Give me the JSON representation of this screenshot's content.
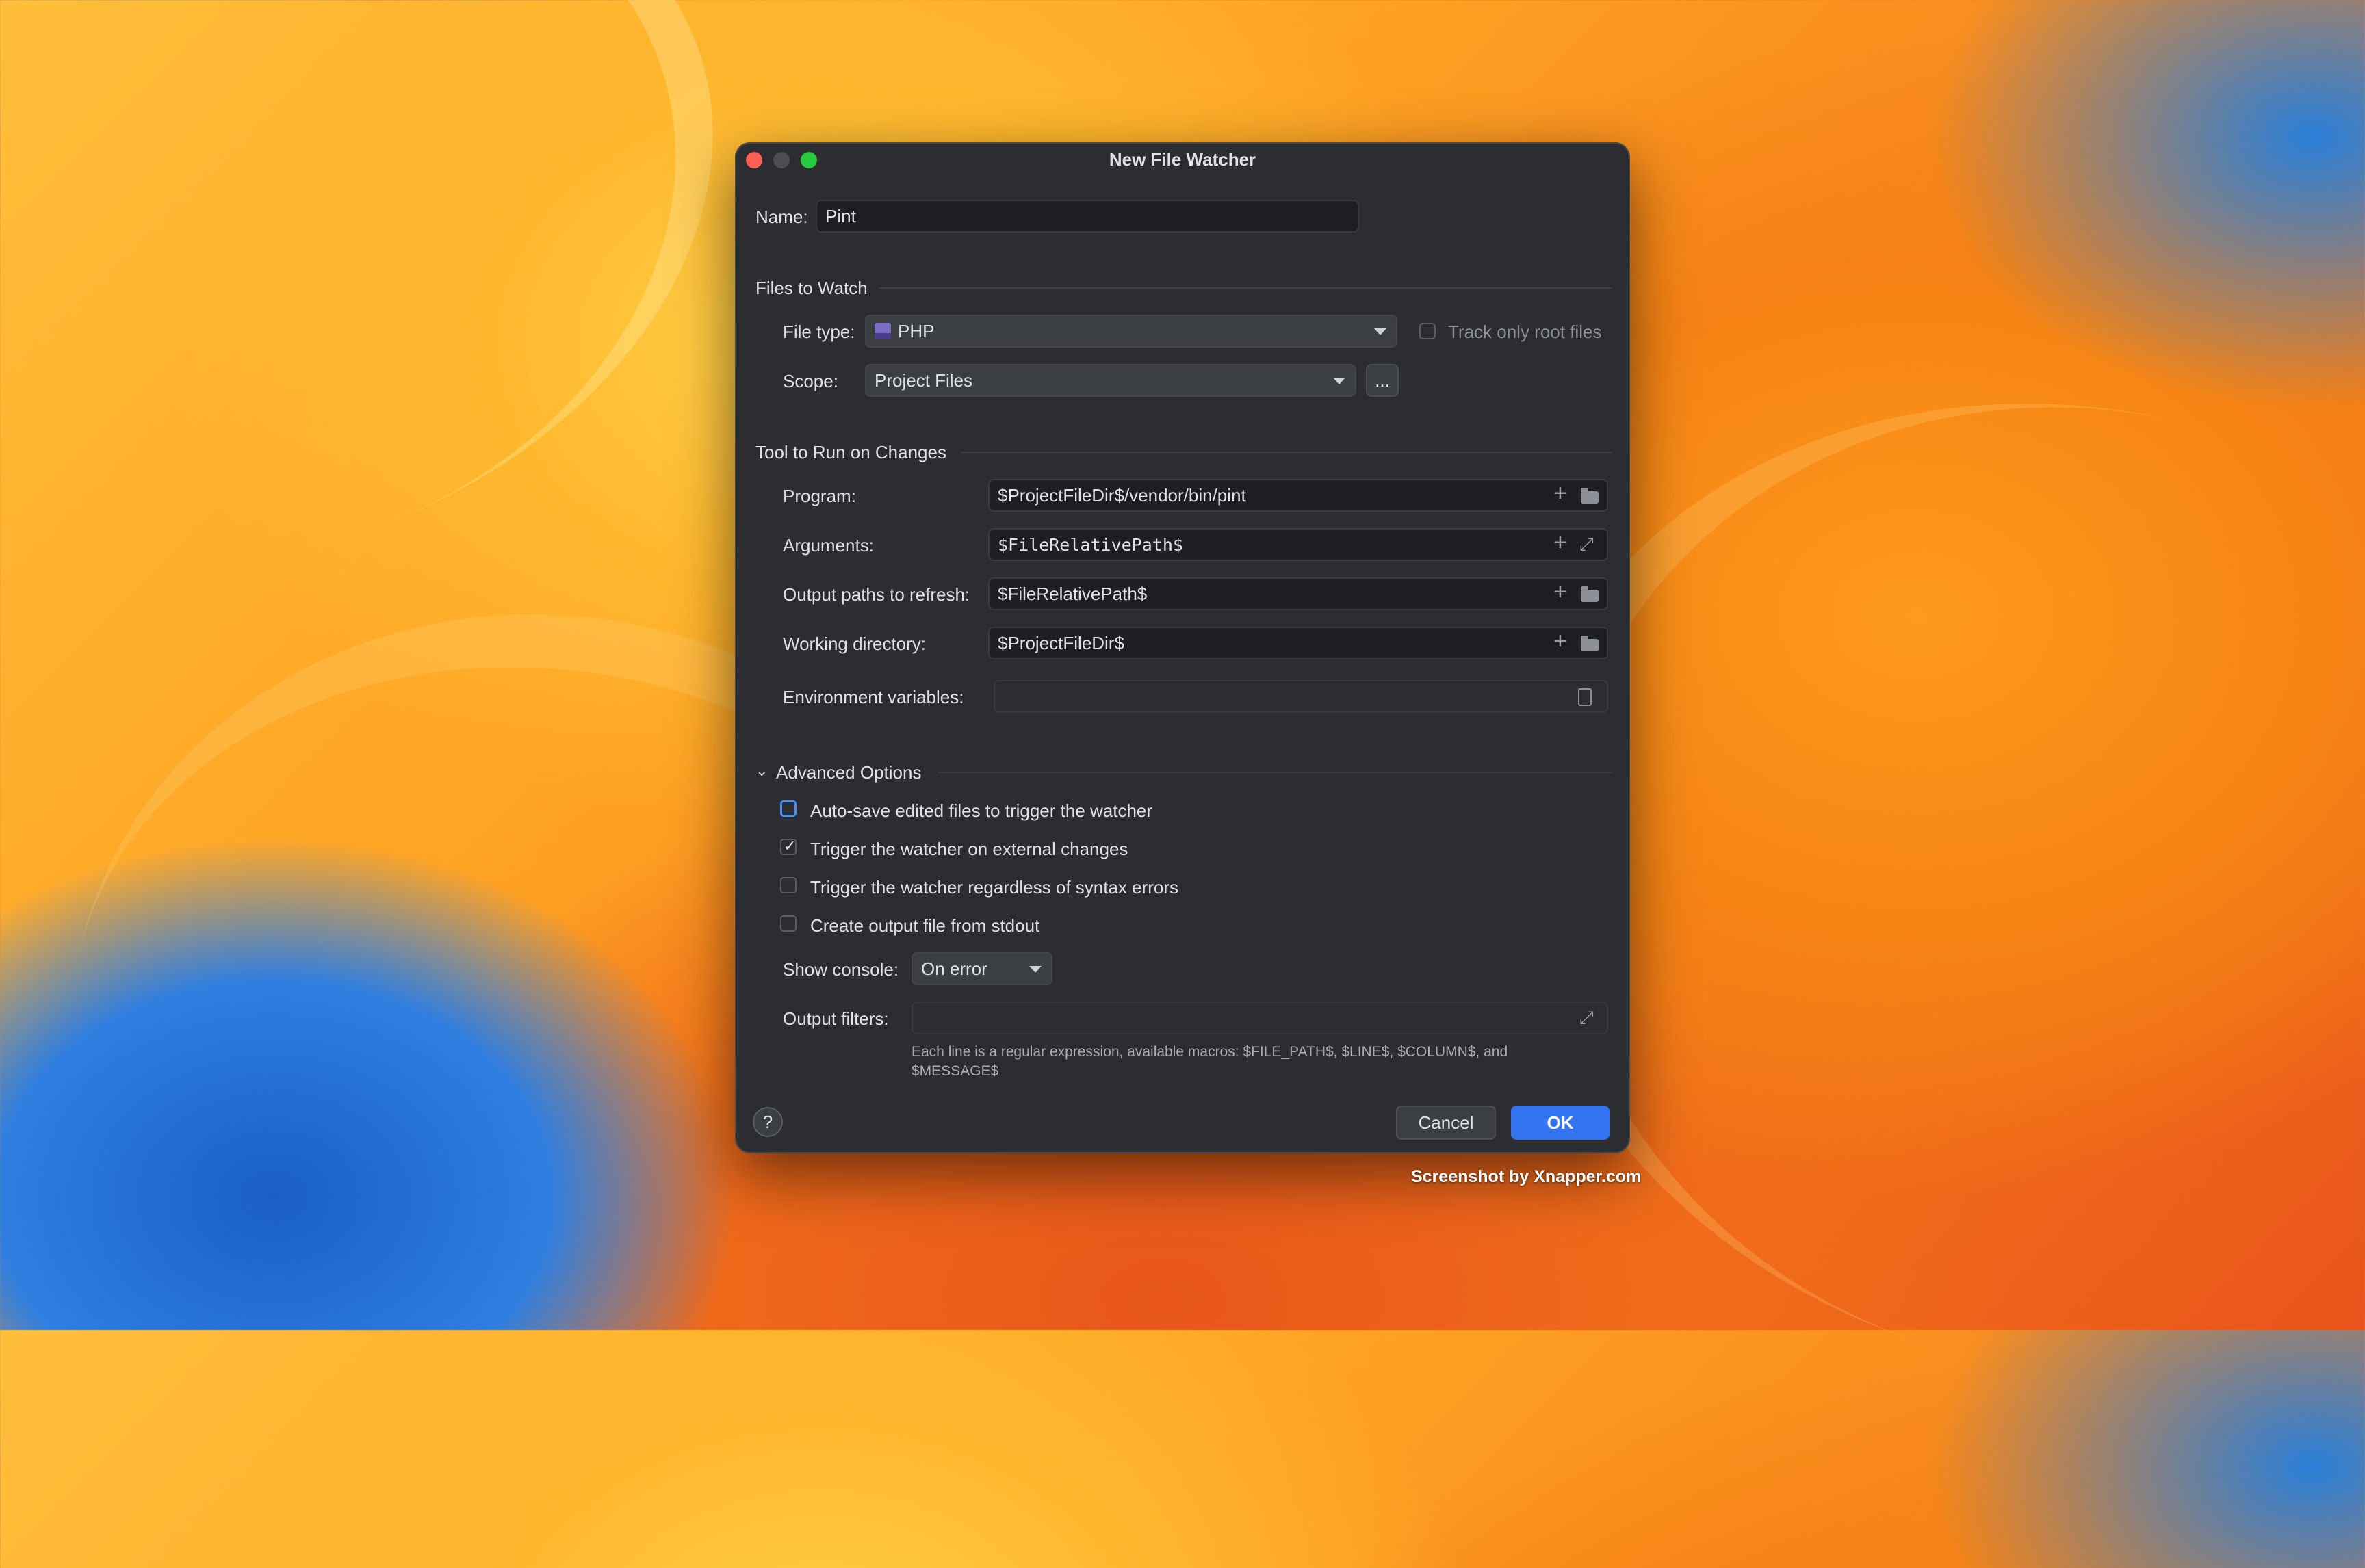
{
  "window": {
    "title": "New File Watcher"
  },
  "name": {
    "label": "Name:",
    "value": "Pint"
  },
  "files_to_watch": {
    "section_title": "Files to Watch",
    "file_type": {
      "label": "File type:",
      "value": "PHP"
    },
    "track_only_root_files": {
      "label": "Track only root files",
      "checked": false
    },
    "scope": {
      "label": "Scope:",
      "value": "Project Files",
      "browse_label": "..."
    }
  },
  "tool": {
    "section_title": "Tool to Run on Changes",
    "program": {
      "label": "Program:",
      "value": "$ProjectFileDir$/vendor/bin/pint"
    },
    "arguments": {
      "label": "Arguments:",
      "value": "$FileRelativePath$"
    },
    "output_paths": {
      "label": "Output paths to refresh:",
      "value": "$FileRelativePath$"
    },
    "working_directory": {
      "label": "Working directory:",
      "value": "$ProjectFileDir$"
    },
    "env_vars": {
      "label": "Environment variables:",
      "value": ""
    }
  },
  "advanced": {
    "section_title": "Advanced Options",
    "options": [
      {
        "label": "Auto-save edited files to trigger the watcher",
        "checked": false
      },
      {
        "label": "Trigger the watcher on external changes",
        "checked": true
      },
      {
        "label": "Trigger the watcher regardless of syntax errors",
        "checked": false
      },
      {
        "label": "Create output file from stdout",
        "checked": false
      }
    ],
    "show_console": {
      "label": "Show console:",
      "value": "On error"
    },
    "output_filters": {
      "label": "Output filters:",
      "value": "",
      "hint_line1": "Each line is a regular expression, available macros: $FILE_PATH$, $LINE$, $COLUMN$, and",
      "hint_line2": "$MESSAGE$"
    }
  },
  "footer": {
    "help": "?",
    "cancel": "Cancel",
    "ok": "OK"
  },
  "credit": "Screenshot by Xnapper.com",
  "colors": {
    "accent": "#4c8df6",
    "dialog_bg": "#2b2d30",
    "ok_button": "#3574f0"
  }
}
